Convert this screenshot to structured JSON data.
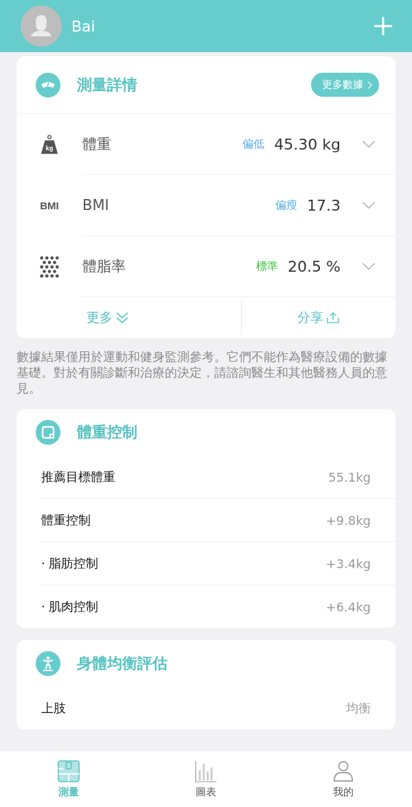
{
  "header": {
    "user_name": "Bai"
  },
  "measure_card": {
    "title": "測量詳情",
    "more_data_button": "更多數據",
    "metrics": [
      {
        "kind": "weight",
        "icon_text": "kg",
        "name": "體重",
        "status": "偏低",
        "color": "#5aaee6",
        "value": "45.30 kg",
        "expanded": false
      },
      {
        "kind": "bmi",
        "icon_text": "BMI",
        "name": "BMI",
        "status": "偏瘦",
        "color": "#5aaee6",
        "value": "17.3",
        "expanded": false
      },
      {
        "kind": "fat",
        "name": "體脂率",
        "status": "標準",
        "color": "#3cc43c",
        "value": "20.5 %",
        "expanded": false
      }
    ],
    "more_button": "更多",
    "share_button": "分享"
  },
  "disclaimer": "數據結果僅用於運動和健身監測參考。它們不能作為醫療設備的數據基礎。對於有關診斷和治療的決定，請諮詢醫生和其他醫務人員的意見。",
  "sections": [
    {
      "kind": "weight_control",
      "title": "體重控制",
      "rows": [
        {
          "label": "推薦目標體重",
          "value": "55.1kg"
        },
        {
          "label": "體重控制",
          "value": "+9.8kg"
        },
        {
          "label": "· 脂肪控制",
          "value": "+3.4kg"
        },
        {
          "label": "· 肌肉控制",
          "value": "+6.4kg"
        }
      ]
    },
    {
      "kind": "balance",
      "title": "身體均衡評估",
      "rows": [
        {
          "label": "上肢",
          "value": "均衡"
        }
      ]
    }
  ],
  "tabs": [
    {
      "kind": "measure",
      "label": "測量",
      "selected": true
    },
    {
      "kind": "chart",
      "label": "圖表",
      "selected": false
    },
    {
      "kind": "me",
      "label": "我的",
      "selected": false
    }
  ]
}
